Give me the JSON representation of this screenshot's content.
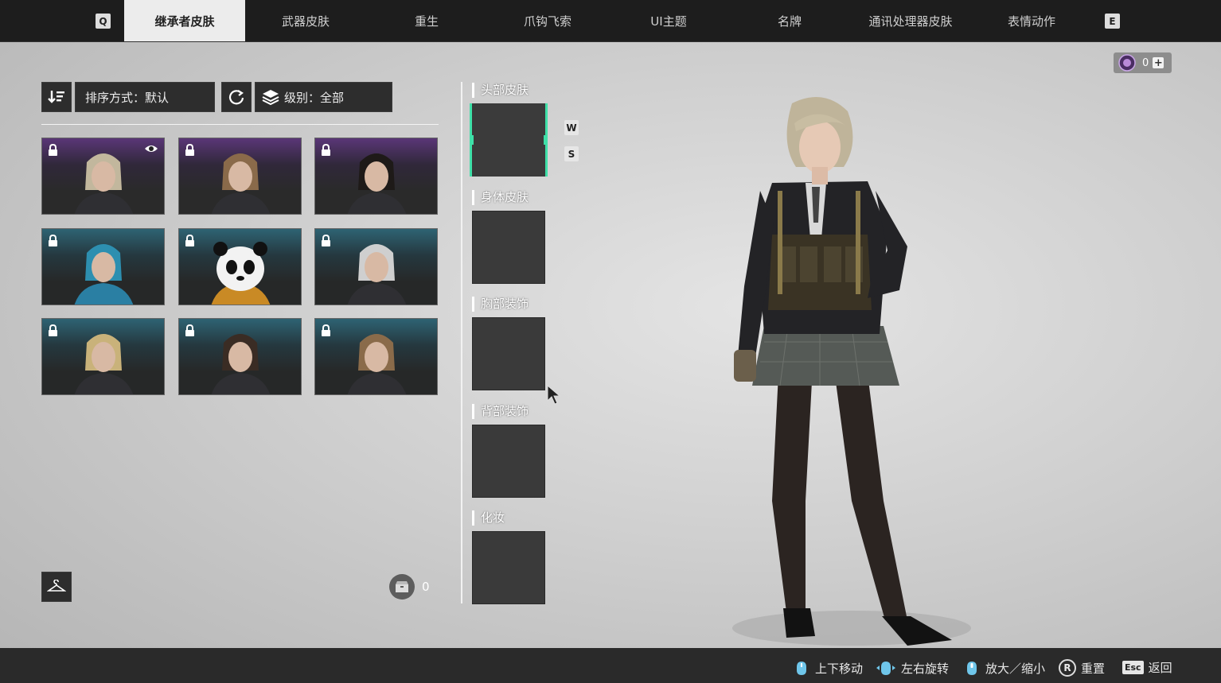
{
  "nav": {
    "prev_key": "Q",
    "next_key": "E",
    "tabs": [
      {
        "label": "继承者皮肤",
        "active": true
      },
      {
        "label": "武器皮肤"
      },
      {
        "label": "重生"
      },
      {
        "label": "爪钩飞索"
      },
      {
        "label": "UI主题"
      },
      {
        "label": "名牌"
      },
      {
        "label": "通讯处理器皮肤"
      },
      {
        "label": "表情动作"
      }
    ]
  },
  "filters": {
    "sort_label": "排序方式：默认",
    "level_label": "级别：全部"
  },
  "skins": [
    {
      "rarity": "purple",
      "locked": true,
      "preview": true
    },
    {
      "rarity": "purple",
      "locked": true
    },
    {
      "rarity": "purple",
      "locked": true
    },
    {
      "rarity": "teal",
      "locked": true
    },
    {
      "rarity": "teal",
      "locked": true
    },
    {
      "rarity": "teal",
      "locked": true
    },
    {
      "rarity": "teal",
      "locked": true
    },
    {
      "rarity": "teal",
      "locked": true
    },
    {
      "rarity": "teal",
      "locked": true
    }
  ],
  "footer_left": {
    "count": "0"
  },
  "slots": {
    "head": "头部皮肤",
    "body": "身体皮肤",
    "chest": "胸部装饰",
    "back": "背部装饰",
    "makeup": "化妆",
    "up_key": "W",
    "down_key": "S"
  },
  "currency": {
    "amount": "0",
    "add": "+"
  },
  "hints": {
    "move": "上下移动",
    "rotate": "左右旋转",
    "zoom": "放大／缩小",
    "reset_key": "R",
    "reset": "重置",
    "back_key": "Esc",
    "back": "返回"
  },
  "colors": {
    "accent": "#3fe0a8",
    "rarity_purple": "#5a3677",
    "rarity_teal": "#2e6373"
  }
}
